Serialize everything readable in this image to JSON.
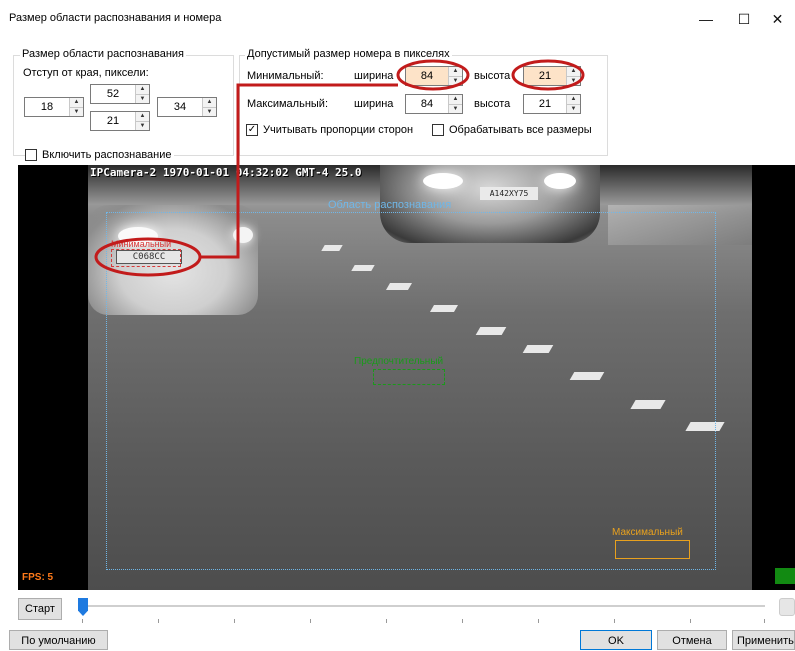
{
  "window": {
    "title": "Размер области распознавания и номера",
    "minimize_glyph": "—",
    "maximize_glyph": "☐",
    "close_glyph": "✕"
  },
  "area_group": {
    "title": "Размер области распознавания",
    "indent_label": "Отступ от края, пиксели:",
    "top": "52",
    "left": "18",
    "right": "34",
    "bottom": "21",
    "enable_label": "Включить распознавание",
    "enable_checked": false
  },
  "plate_group": {
    "title": "Допустимый размер номера в пикселях",
    "min_label": "Минимальный:",
    "max_label": "Максимальный:",
    "width_label": "ширина",
    "height_label": "высота",
    "min_width": "84",
    "min_height": "21",
    "max_width": "84",
    "max_height": "21",
    "keep_ratio_label": "Учитывать пропорции сторон",
    "keep_ratio_checked": true,
    "all_sizes_label": "Обрабатывать все размеры",
    "all_sizes_checked": false
  },
  "video": {
    "osd": "IPCamera-2 1970-01-01 04:32:02 GMT-4  25.0",
    "region_label": "Область распознавания",
    "min_label": "Минимальный",
    "preferred_label": "Предпочтительный",
    "max_label": "Максимальный",
    "fps": "FPS: 5",
    "left_plate": "C068CC",
    "right_plate": "A142XY75"
  },
  "controls": {
    "start_label": "Старт",
    "timeline_progress": 0.0
  },
  "footer": {
    "default_label": "По умолчанию",
    "ok_label": "OK",
    "cancel_label": "Отмена",
    "apply_label": "Применить"
  },
  "colors": {
    "annotation_red": "#c21b1b",
    "region_blue": "#6fb7e8",
    "preferred_green": "#1a9a1a",
    "max_orange": "#e8a11e",
    "min_red": "#d83a3a",
    "slider_thumb": "#1e7ae0",
    "fps_orange": "#ff7a1a",
    "status_green": "#128a12"
  }
}
